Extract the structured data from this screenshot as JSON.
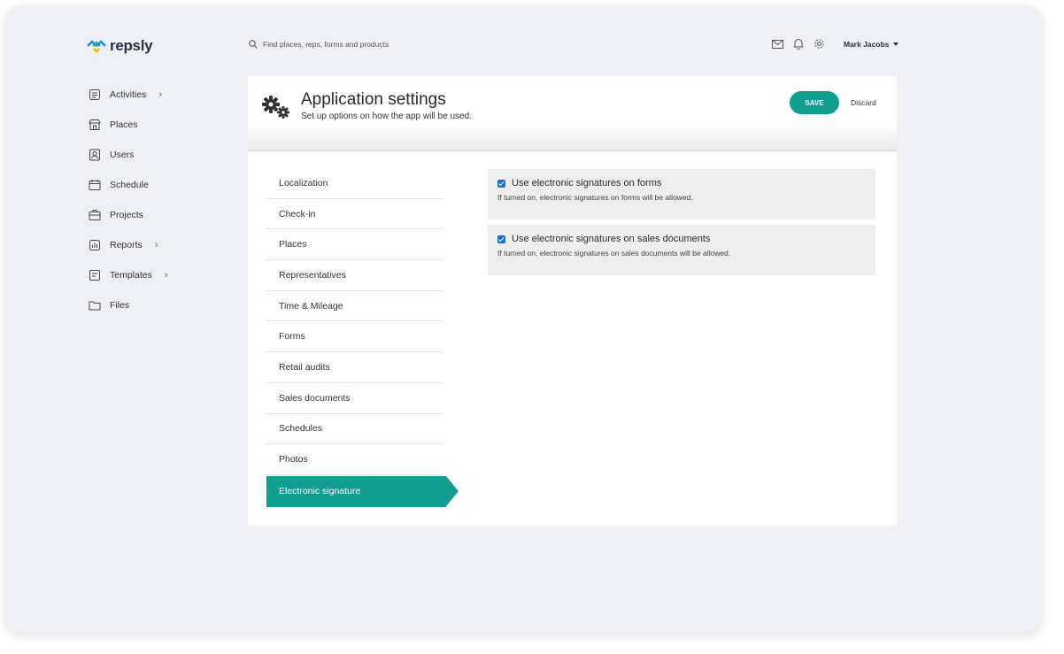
{
  "app": {
    "logo_text": "repsly"
  },
  "search": {
    "placeholder": "Find places, reps, forms and products"
  },
  "header": {
    "user_name": "Mark Jacobs"
  },
  "sidebar": {
    "items": [
      {
        "label": "Activities",
        "icon": "clipboard-icon",
        "has_submenu": true
      },
      {
        "label": "Places",
        "icon": "store-icon",
        "has_submenu": false
      },
      {
        "label": "Users",
        "icon": "user-badge-icon",
        "has_submenu": false
      },
      {
        "label": "Schedule",
        "icon": "calendar-icon",
        "has_submenu": false
      },
      {
        "label": "Projects",
        "icon": "briefcase-icon",
        "has_submenu": false
      },
      {
        "label": "Reports",
        "icon": "bar-chart-icon",
        "has_submenu": true
      },
      {
        "label": "Templates",
        "icon": "template-icon",
        "has_submenu": true
      },
      {
        "label": "Files",
        "icon": "folder-icon",
        "has_submenu": false
      }
    ]
  },
  "page": {
    "title": "Application settings",
    "subtitle": "Set up options on how the app will be used.",
    "save_label": "SAVE",
    "discard_label": "Discard"
  },
  "settings_menu": {
    "items": [
      "Localization",
      "Check-in",
      "Places",
      "Representatives",
      "Time & Mileage",
      "Forms",
      "Retail audits",
      "Sales documents",
      "Schedules",
      "Photos",
      "Electronic signature"
    ],
    "active_index": 10
  },
  "options": [
    {
      "label": "Use electronic signatures on forms",
      "description": "If turned on, electronic signatures on forms will be allowed.",
      "checked": true
    },
    {
      "label": "Use electronic signatures on sales documents",
      "description": "If turned on, electronic signatures on sales documents will be allowed.",
      "checked": true
    }
  ],
  "colors": {
    "accent": "#109e90",
    "checkbox": "#1a6fd6",
    "background": "#eef0f5"
  }
}
